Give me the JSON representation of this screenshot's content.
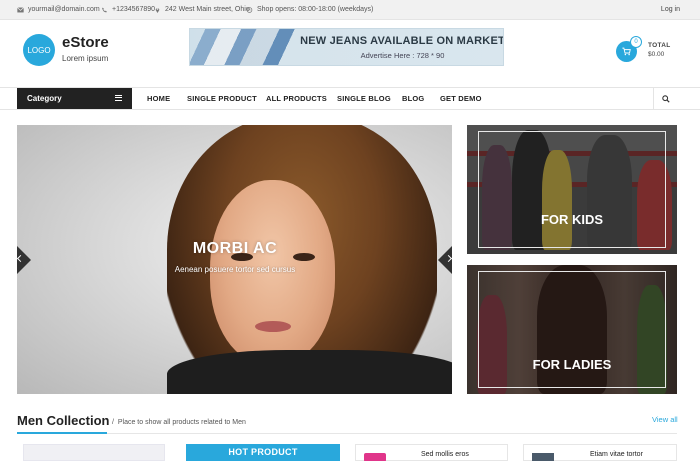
{
  "topbar": {
    "email": "yourmail@domain.com",
    "phone": "+1234567890",
    "address": "242 West Main street, Ohio",
    "hours": "Shop opens: 08:00-18:00 (weekdays)",
    "login": "Log in"
  },
  "header": {
    "logo": "LOGO",
    "brand": "eStore",
    "tagline": "Lorem ipsum",
    "banner_title": "NEW JEANS AVAILABLE ON MARKET",
    "banner_sub": "Advertise Here : 728 * 90",
    "cart_count": "0",
    "cart_label": "TOTAL",
    "cart_total": "$0.00"
  },
  "nav": {
    "category": "Category",
    "items": [
      "HOME",
      "SINGLE PRODUCT",
      "ALL PRODUCTS",
      "SINGLE BLOG",
      "BLOG",
      "GET DEMO"
    ]
  },
  "hero": {
    "title": "MORBI AC",
    "subtitle": "Aenean posuere tortor sed cursus"
  },
  "promos": {
    "kids": "FOR KIDS",
    "ladies": "FOR LADIES"
  },
  "collection": {
    "title": "Men Collection",
    "subtitle": "Place to show all products related to Men",
    "view_all": "View all",
    "hot_label": "HOT PRODUCT",
    "products": [
      "Sed mollis eros",
      "Etiam vitae tortor"
    ]
  },
  "colors": {
    "accent": "#29a8dc",
    "dark": "#222222"
  },
  "icons": [
    "envelope-icon",
    "phone-icon",
    "map-marker-icon",
    "clock-icon",
    "hamburger-icon",
    "search-icon",
    "cart-icon",
    "chevron-left-icon",
    "chevron-right-icon"
  ]
}
